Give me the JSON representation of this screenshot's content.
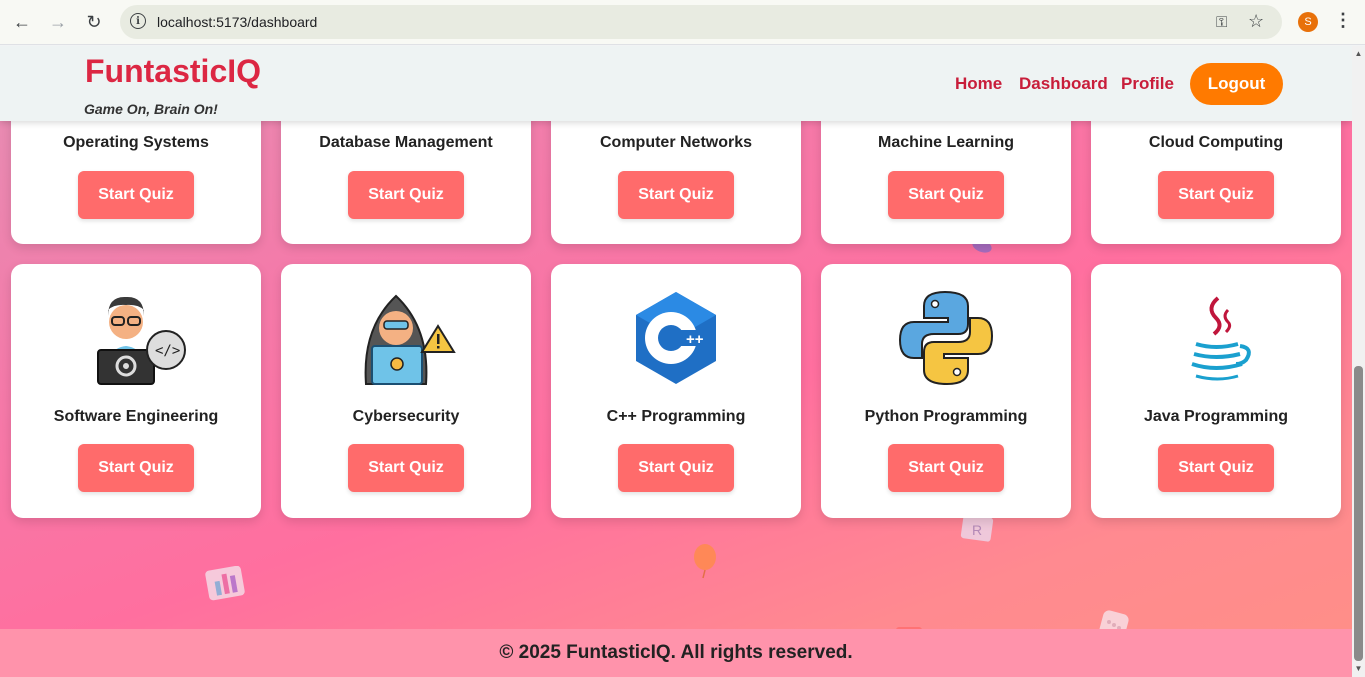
{
  "browser": {
    "url": "localhost:5173/dashboard",
    "profile_initial": "S"
  },
  "header": {
    "brand": "FuntasticIQ",
    "tagline": "Game On, Brain On!",
    "nav": [
      "Home",
      "Dashboard",
      "Profile"
    ],
    "logout": "Logout"
  },
  "cards_row1": [
    {
      "title": "Operating Systems",
      "button": "Start Quiz"
    },
    {
      "title": "Database Management",
      "button": "Start Quiz"
    },
    {
      "title": "Computer Networks",
      "button": "Start Quiz"
    },
    {
      "title": "Machine Learning",
      "button": "Start Quiz"
    },
    {
      "title": "Cloud Computing",
      "button": "Start Quiz"
    }
  ],
  "cards_row2": [
    {
      "title": "Software Engineering",
      "button": "Start Quiz",
      "icon": "developer-laptop-icon"
    },
    {
      "title": "Cybersecurity",
      "button": "Start Quiz",
      "icon": "hacker-icon"
    },
    {
      "title": "C++ Programming",
      "button": "Start Quiz",
      "icon": "cpp-logo-icon"
    },
    {
      "title": "Python Programming",
      "button": "Start Quiz",
      "icon": "python-logo-icon"
    },
    {
      "title": "Java Programming",
      "button": "Start Quiz",
      "icon": "java-logo-icon"
    }
  ],
  "footer": "© 2025 FuntasticIQ. All rights reserved.",
  "colors": {
    "brand": "#dc2743",
    "button": "#ff6b6b",
    "logout": "#ff7a00",
    "footer": "#ff93ab"
  }
}
